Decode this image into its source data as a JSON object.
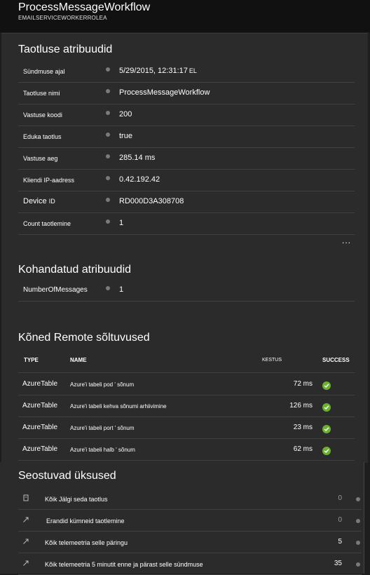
{
  "header": {
    "title": "ProcessMessageWorkflow",
    "subtitle": "EMAILSERVICEWORKERROLEA"
  },
  "request_properties": {
    "title": "Taotluse atribuudid",
    "rows": [
      {
        "key": "Sündmuse ajal",
        "value": "5/29/2015, 12:31:17",
        "suffix": "EL"
      },
      {
        "key": "Taotluse nimi",
        "value": "ProcessMessageWorkflow"
      },
      {
        "key": "Vastuse koodi",
        "value": "200"
      },
      {
        "key": "Eduka taotlus",
        "value": "true"
      },
      {
        "key": "Vastuse aeg",
        "value": "285.14 ms"
      },
      {
        "key": "Kliendi IP-aadress",
        "value": "0.42.192.42"
      },
      {
        "key": "Device",
        "key_suffix": "ID",
        "value": "RD000D3A308708"
      },
      {
        "key": "Count taotlemine",
        "value": "1"
      }
    ],
    "more": "..."
  },
  "custom_properties": {
    "title": "Kohandatud atribuudid",
    "rows": [
      {
        "key": "NumberOfMessages",
        "value": "1"
      }
    ]
  },
  "dependencies": {
    "title": "Kõned Remote sõltuvused",
    "columns": {
      "type": "TYPE",
      "name": "NAME",
      "duration": "KESTUS",
      "success": "SUCCESS"
    },
    "rows": [
      {
        "type": "AzureTable",
        "name": "Azure'i tabeli pod ' sõnum",
        "duration": "72 ms",
        "success": "check-circle-icon"
      },
      {
        "type": "AzureTable",
        "name": "Azure'i tabeli kehva sõnumi arhiivimine",
        "duration": "126 ms",
        "success": "check-circle-icon"
      },
      {
        "type": "AzureTable",
        "name": "Azure'i tabeli port ' sõnum",
        "duration": "23 ms",
        "success": "check-circle-icon"
      },
      {
        "type": "AzureTable",
        "name": "Azure'i tabeli halb ' sõnum",
        "duration": "62 ms",
        "success": "check-circle-icon"
      }
    ]
  },
  "related": {
    "title": "Seostuvad üksused",
    "rows": [
      {
        "icon": "document-icon",
        "label": "Kõik Jälgi seda taotlus",
        "count": "0"
      },
      {
        "icon": "arrow-icon",
        "label": "Erandid kümneid taotlemine",
        "count": "0"
      },
      {
        "icon": "arrow-icon",
        "label": "Kõik telemeetria selle päringu",
        "count": "5"
      },
      {
        "icon": "arrow-icon",
        "label": "Kõik telemeetria 5 minutit enne ja pärast selle sündmuse",
        "count": "35"
      }
    ]
  },
  "colors": {
    "background": "#2b2b2b",
    "header": "#111111",
    "success": "#6bb12f"
  }
}
